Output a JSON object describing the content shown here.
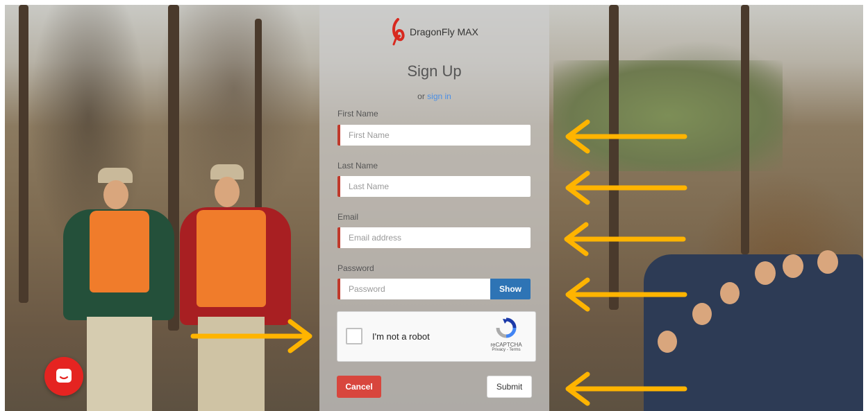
{
  "app": {
    "logo_text": "DragonFly MAX"
  },
  "form": {
    "title": "Sign Up",
    "or_text": "or",
    "signin_link": "sign in",
    "first_name": {
      "label": "First Name",
      "placeholder": "First Name",
      "value": ""
    },
    "last_name": {
      "label": "Last Name",
      "placeholder": "Last Name",
      "value": ""
    },
    "email": {
      "label": "Email",
      "placeholder": "Email address",
      "value": ""
    },
    "password": {
      "label": "Password",
      "placeholder": "Password",
      "value": "",
      "show_label": "Show"
    },
    "recaptcha": {
      "label": "I'm not a robot",
      "brand": "reCAPTCHA",
      "links": "Privacy - Terms",
      "checked": false
    },
    "cancel_label": "Cancel",
    "submit_label": "Submit"
  },
  "colors": {
    "accent_red": "#d8463d",
    "field_border": "#c0392b",
    "show_button": "#2e74b5",
    "link_blue": "#4b8fe5",
    "arrow_yellow": "#ffb400",
    "chat_red": "#e52421"
  },
  "icons": {
    "logo": "dragonfly-logo-icon",
    "chat": "chat-icon",
    "recaptcha": "recaptcha-icon",
    "annotation_arrow": "arrow-icon"
  }
}
